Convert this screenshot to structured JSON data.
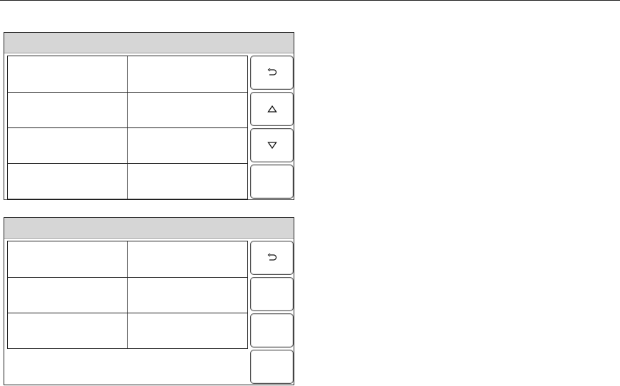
{
  "icons": {
    "back": "undo-arrow-icon",
    "up": "triangle-up-icon",
    "down": "triangle-down-icon"
  },
  "panel_top": {
    "title": "",
    "rows": [
      {
        "label": "",
        "value": ""
      },
      {
        "label": "",
        "value": ""
      },
      {
        "label": "",
        "value": ""
      },
      {
        "label": "",
        "value": ""
      }
    ],
    "buttons": [
      "back",
      "up",
      "down",
      "blank"
    ]
  },
  "panel_bottom": {
    "title": "",
    "rows": [
      {
        "label": "",
        "value": ""
      },
      {
        "label": "",
        "value": ""
      },
      {
        "label": "",
        "value": ""
      }
    ],
    "buttons": [
      "back",
      "blank",
      "blank",
      "blank"
    ]
  }
}
